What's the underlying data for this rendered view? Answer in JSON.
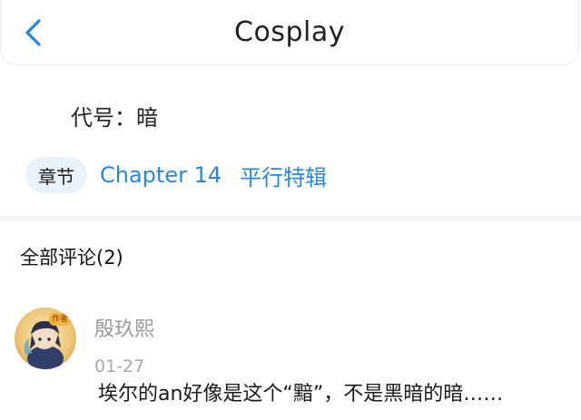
{
  "header": {
    "title": "Cosplay",
    "back_icon": "chevron-left-icon"
  },
  "codename": "代号：暗",
  "chapter": {
    "tag": "章节",
    "links": [
      "Chapter 14",
      "平行特辑"
    ]
  },
  "comments": {
    "header": "全部评论(2)",
    "items": [
      {
        "username": "殷玖熙",
        "badge": "作者",
        "date": "01-27",
        "text": "埃尔的an好像是这个“黯”，不是黑暗的暗……"
      }
    ]
  },
  "colors": {
    "accent": "#2a86d6",
    "pill_bg": "#e9f2fb"
  }
}
